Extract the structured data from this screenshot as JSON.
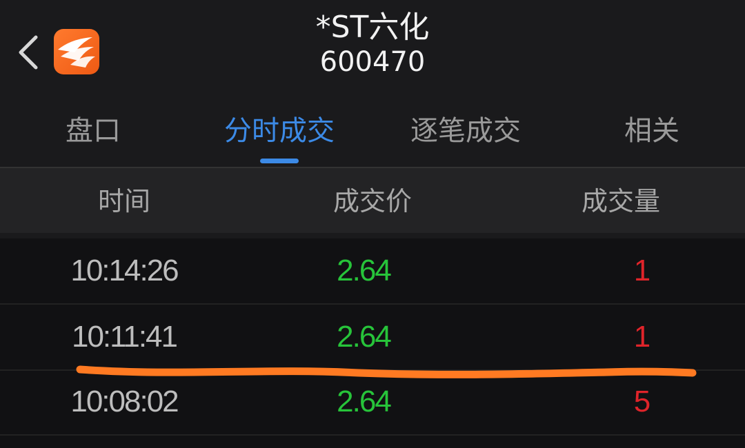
{
  "header": {
    "back_icon": "chevron-left-icon",
    "logo_icon": "app-logo-icon",
    "stock_name": "*ST六化",
    "stock_code": "600470"
  },
  "tabs": [
    {
      "label": "盘口",
      "active": false
    },
    {
      "label": "分时成交",
      "active": true
    },
    {
      "label": "逐笔成交",
      "active": false
    },
    {
      "label": "相关",
      "active": false
    }
  ],
  "columns": {
    "time": "时间",
    "price": "成交价",
    "volume": "成交量"
  },
  "trades": [
    {
      "time": "10:14:26",
      "price": "2.64",
      "volume": "1"
    },
    {
      "time": "10:11:41",
      "price": "2.64",
      "volume": "1"
    },
    {
      "time": "10:08:02",
      "price": "2.64",
      "volume": "5"
    }
  ],
  "colors": {
    "accent": "#3c8ae6",
    "price_down": "#27c43a",
    "volume": "#e0242a",
    "annotation": "#ff7a22"
  }
}
